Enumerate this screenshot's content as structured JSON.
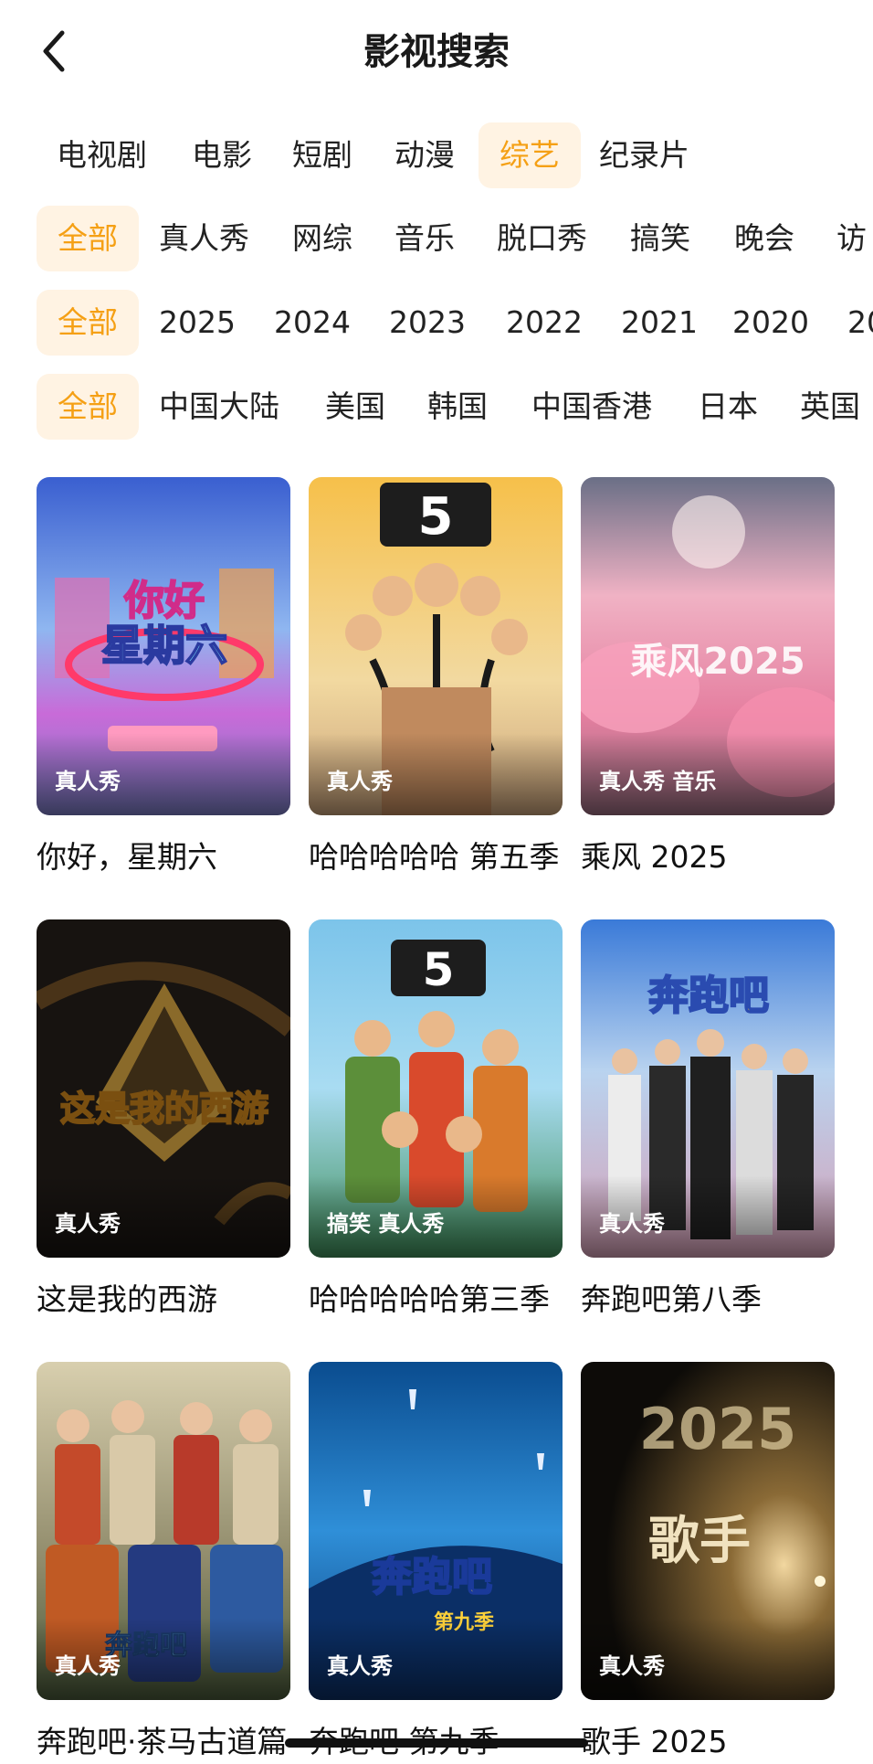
{
  "header": {
    "title": "影视搜索",
    "back_icon": "chevron-left-icon"
  },
  "filters": {
    "category": {
      "items": [
        "电视剧",
        "电影",
        "短剧",
        "动漫",
        "综艺",
        "纪录片"
      ],
      "active_index": 4
    },
    "genre": {
      "items": [
        "全部",
        "真人秀",
        "网综",
        "音乐",
        "脱口秀",
        "搞笑",
        "晚会",
        "访"
      ],
      "active_index": 0
    },
    "year": {
      "items": [
        "全部",
        "2025",
        "2024",
        "2023",
        "2022",
        "2021",
        "2020",
        "20"
      ],
      "active_index": 0
    },
    "region": {
      "items": [
        "全部",
        "中国大陆",
        "美国",
        "韩国",
        "中国香港",
        "日本",
        "英国"
      ],
      "active_index": 0
    }
  },
  "results": [
    {
      "title": "你好，星期六",
      "tags": "真人秀"
    },
    {
      "title": "哈哈哈哈哈 第五季",
      "tags": "真人秀"
    },
    {
      "title": "乘风 2025",
      "tags": "真人秀 音乐"
    },
    {
      "title": "这是我的西游",
      "tags": "真人秀"
    },
    {
      "title": "哈哈哈哈哈第三季",
      "tags": "搞笑 真人秀"
    },
    {
      "title": "奔跑吧第八季",
      "tags": "真人秀"
    },
    {
      "title": "奔跑吧·茶马古道篇",
      "tags": "真人秀"
    },
    {
      "title": "奔跑吧 第九季",
      "tags": "真人秀"
    },
    {
      "title": "歌手 2025",
      "tags": "真人秀"
    }
  ],
  "colors": {
    "accent": "#f5a015",
    "accent_bg": "#fff3e3"
  }
}
